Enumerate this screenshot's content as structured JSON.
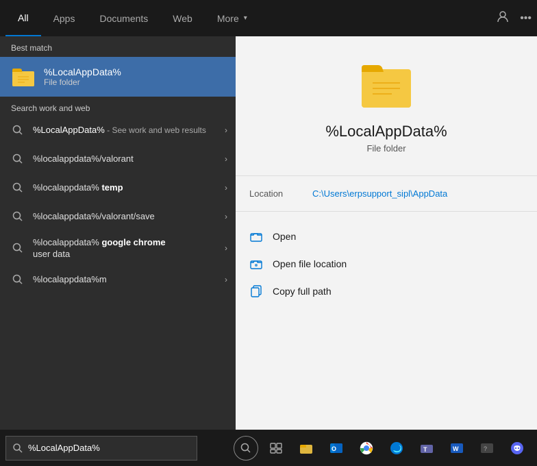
{
  "nav": {
    "tabs": [
      {
        "id": "all",
        "label": "All",
        "active": true
      },
      {
        "id": "apps",
        "label": "Apps",
        "active": false
      },
      {
        "id": "documents",
        "label": "Documents",
        "active": false
      },
      {
        "id": "web",
        "label": "Web",
        "active": false
      },
      {
        "id": "more",
        "label": "More",
        "active": false,
        "has_arrow": true
      }
    ]
  },
  "best_match": {
    "section_label": "Best match",
    "title": "%LocalAppData%",
    "subtitle": "File folder"
  },
  "search_section": {
    "label": "Search work and web",
    "results": [
      {
        "id": 0,
        "primary": "%LocalAppData%",
        "secondary": " - See work and web results",
        "has_chevron": true,
        "multi_line": true
      },
      {
        "id": 1,
        "primary": "%localappdata%/valorant",
        "has_chevron": true,
        "multi_line": false
      },
      {
        "id": 2,
        "primary": "%localappdata% temp",
        "has_chevron": true,
        "multi_line": false
      },
      {
        "id": 3,
        "primary": "%localappdata%/valorant/save",
        "has_chevron": true,
        "multi_line": false
      },
      {
        "id": 4,
        "primary": "%localappdata% google chrome user data",
        "display_primary": "%localappdata%",
        "display_bold": " google chrome",
        "display_rest": " user data",
        "has_chevron": true,
        "multi_line": true
      },
      {
        "id": 5,
        "primary": "%localappdata%m",
        "has_chevron": true,
        "multi_line": false
      }
    ]
  },
  "preview": {
    "title": "%LocalAppData%",
    "subtitle": "File folder",
    "location_label": "Location",
    "location_value": "C:\\Users\\erpsupport_sipl\\AppData",
    "actions": [
      {
        "id": "open",
        "label": "Open",
        "icon": "folder-open-icon"
      },
      {
        "id": "open-file-location",
        "label": "Open file location",
        "icon": "folder-location-icon"
      },
      {
        "id": "copy-full-path",
        "label": "Copy full path",
        "icon": "copy-icon"
      }
    ]
  },
  "taskbar": {
    "search_value": "%LocalAppData%",
    "search_placeholder": "%LocalAppData%"
  }
}
